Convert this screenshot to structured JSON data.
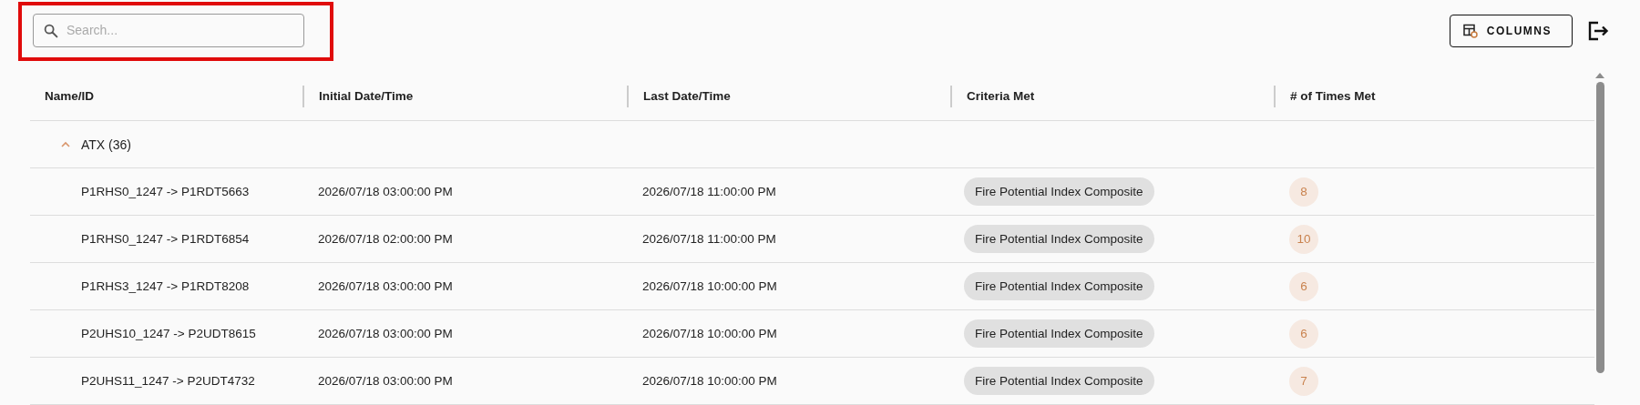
{
  "search": {
    "placeholder": "Search...",
    "highlighted": true
  },
  "toolbar": {
    "columns_button": "COLUMNS"
  },
  "table": {
    "columns": [
      "Name/ID",
      "Initial Date/Time",
      "Last Date/Time",
      "Criteria Met",
      "# of Times Met"
    ],
    "groups": [
      {
        "label": "ATX (36)",
        "expanded": true,
        "rows": [
          {
            "name": "P1RHS0_1247 -> P1RDT5663",
            "initial": "2026/07/18 03:00:00 PM",
            "last": "2026/07/18 11:00:00 PM",
            "criteria": "Fire Potential Index Composite",
            "times": "8"
          },
          {
            "name": "P1RHS0_1247 -> P1RDT6854",
            "initial": "2026/07/18 02:00:00 PM",
            "last": "2026/07/18 11:00:00 PM",
            "criteria": "Fire Potential Index Composite",
            "times": "10"
          },
          {
            "name": "P1RHS3_1247 -> P1RDT8208",
            "initial": "2026/07/18 03:00:00 PM",
            "last": "2026/07/18 10:00:00 PM",
            "criteria": "Fire Potential Index Composite",
            "times": "6"
          },
          {
            "name": "P2UHS10_1247 -> P2UDT8615",
            "initial": "2026/07/18 03:00:00 PM",
            "last": "2026/07/18 10:00:00 PM",
            "criteria": "Fire Potential Index Composite",
            "times": "6"
          },
          {
            "name": "P2UHS11_1247 -> P2UDT4732",
            "initial": "2026/07/18 03:00:00 PM",
            "last": "2026/07/18 10:00:00 PM",
            "criteria": "Fire Potential Index Composite",
            "times": "7"
          }
        ]
      }
    ]
  }
}
